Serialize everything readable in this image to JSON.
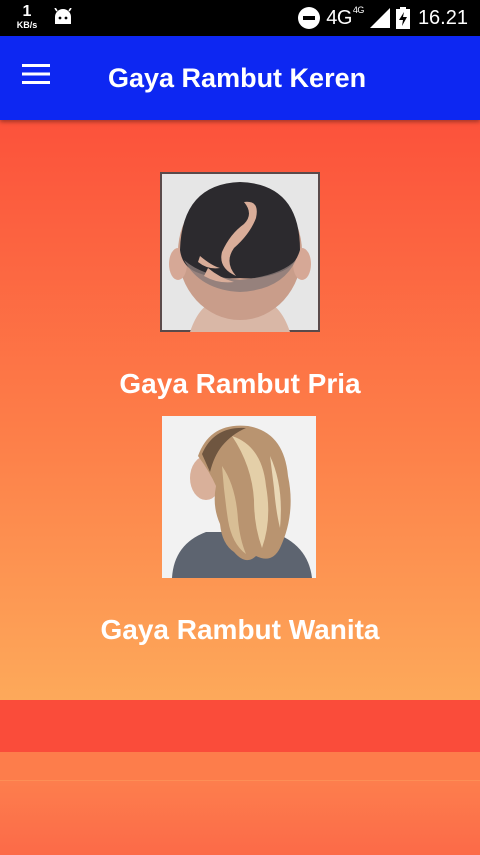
{
  "status_bar": {
    "speed_value": "1",
    "speed_unit": "KB/s",
    "notification_icon": "android-icon",
    "dnd_icon": "do-not-disturb-icon",
    "network": "4G",
    "network_small": "4G",
    "signal_icon": "signal-icon",
    "battery_icon": "battery-charging-icon",
    "time": "16.21"
  },
  "app_bar": {
    "menu_icon": "hamburger-menu-icon",
    "title": "Gaya Rambut Keren",
    "background": "#0d27f2"
  },
  "menu": {
    "items": [
      {
        "label": "Gaya Rambut Pria",
        "image_icon": "mens-haircut-photo"
      },
      {
        "label": "Gaya Rambut Wanita",
        "image_icon": "womens-hairstyle-photo"
      }
    ]
  },
  "colors": {
    "gradient_top": "#fc523b",
    "gradient_bottom": "#fda95a",
    "footer_band": "#fa4c3a"
  }
}
